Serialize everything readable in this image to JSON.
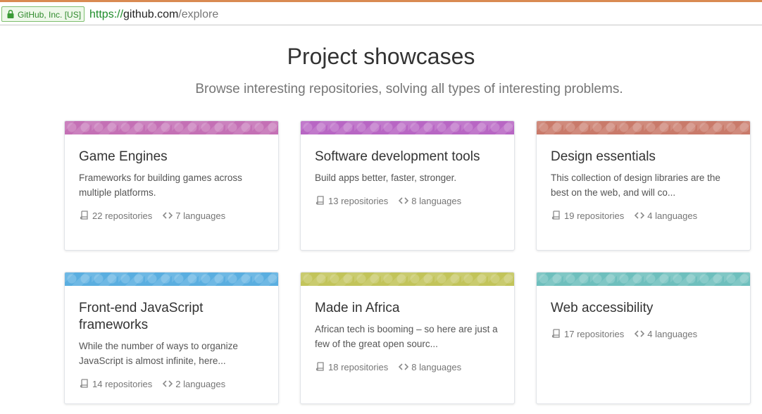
{
  "browser": {
    "ev_badge": "GitHub, Inc. [US]",
    "url_scheme": "https://",
    "url_host": "github.com",
    "url_path": "/explore"
  },
  "header": {
    "title": "Project showcases",
    "subtitle": "Browse interesting repositories, solving all types of interesting problems."
  },
  "cards": [
    {
      "title": "Game Engines",
      "description": "Frameworks for building games across multiple platforms.",
      "repositories": "22 repositories",
      "languages": "7 languages",
      "banner_color": "#c470b5"
    },
    {
      "title": "Software development tools",
      "description": "Build apps better, faster, stronger.",
      "repositories": "13 repositories",
      "languages": "8 languages",
      "banner_color": "#b866c4"
    },
    {
      "title": "Design essentials",
      "description": "This collection of design libraries are the best on the web, and will co...",
      "repositories": "19 repositories",
      "languages": "4 languages",
      "banner_color": "#c97a6a"
    },
    {
      "title": "Front-end JavaScript frameworks",
      "description": "While the number of ways to organize JavaScript is almost infinite, here...",
      "repositories": "14 repositories",
      "languages": "2 languages",
      "banner_color": "#5aaee0"
    },
    {
      "title": "Made in Africa",
      "description": "African tech is booming – so here are just a few of the great open sourc...",
      "repositories": "18 repositories",
      "languages": "8 languages",
      "banner_color": "#c2c45a"
    },
    {
      "title": "Web accessibility",
      "description": "",
      "repositories": "17 repositories",
      "languages": "4 languages",
      "banner_color": "#6ebfbd"
    }
  ]
}
